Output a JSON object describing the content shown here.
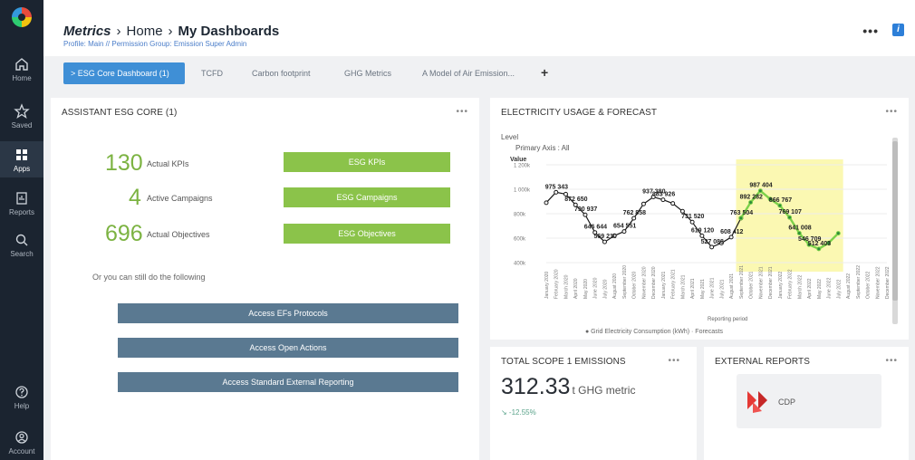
{
  "sidebar": {
    "items": [
      {
        "label": "Home"
      },
      {
        "label": "Saved"
      },
      {
        "label": "Apps"
      },
      {
        "label": "Reports"
      },
      {
        "label": "Search"
      },
      {
        "label": "Help"
      },
      {
        "label": "Account"
      }
    ]
  },
  "header": {
    "crumb1": "Metrics",
    "crumb2": "Home",
    "crumb3": "My Dashboards",
    "subcrumb": "Profile: Main // Permission Group: Emission Super Admin",
    "more": "•••"
  },
  "tabs": [
    {
      "label": "> ESG Core Dashboard (1)"
    },
    {
      "label": "TCFD"
    },
    {
      "label": "Carbon footprint"
    },
    {
      "label": "GHG Metrics"
    },
    {
      "label": "A Model of Air Emission..."
    }
  ],
  "tab_add": "+",
  "esg_panel": {
    "title": "ASSISTANT ESG CORE (1)",
    "more": "•••",
    "kpis": [
      {
        "value": "130",
        "label": "Actual KPIs",
        "button": "ESG KPIs"
      },
      {
        "value": "4",
        "label": "Active Campaigns",
        "button": "ESG Campaigns"
      },
      {
        "value": "696",
        "label": "Actual Objectives",
        "button": "ESG Objectives"
      }
    ],
    "hint": "Or you can still do the following",
    "actions": [
      {
        "label": "Access EFs Protocols"
      },
      {
        "label": "Access Open Actions"
      },
      {
        "label": "Access Standard External Reporting"
      }
    ]
  },
  "electricity_panel": {
    "title": "ELECTRICITY USAGE & FORECAST",
    "more": "•••",
    "level_label": "Level",
    "axis_label": "Primary Axis : All",
    "value_label": "Value",
    "xaxis_title": "Reporting period",
    "legend_text": "● Grid Electricity Consumption (kWh) · Forecasts"
  },
  "chart_data": {
    "type": "line",
    "xlabel": "Reporting period",
    "ylabel": "Value",
    "yticks": [
      "1 200k",
      "1 000k",
      "800k",
      "600k",
      "400k"
    ],
    "ylim": [
      400000,
      1200000
    ],
    "x": [
      "January 2020",
      "February 2020",
      "March 2020",
      "April 2020",
      "May 2020",
      "June 2020",
      "July 2020",
      "August 2020",
      "September 2020",
      "October 2020",
      "November 2020",
      "December 2020",
      "January 2021",
      "February 2021",
      "March 2021",
      "April 2021",
      "May 2021",
      "June 2021",
      "July 2021",
      "August 2021",
      "September 2021",
      "October 2021",
      "November 2021",
      "December 2021",
      "January 2022",
      "February 2022",
      "March 2022",
      "April 2022",
      "May 2022",
      "June 2022",
      "July 2022",
      "August 2022",
      "September 2022",
      "October 2022",
      "November 2022",
      "December 2022"
    ],
    "series": [
      {
        "name": "Grid Electricity Consumption (kWh)",
        "values": [
          890000,
          975343,
          960000,
          872650,
          790937,
          646644,
          569210,
          620000,
          654551,
          762858,
          880000,
          937380,
          913926,
          883926,
          820000,
          731520,
          619120,
          527088,
          560000,
          608412,
          763504,
          null,
          null,
          null,
          null,
          null,
          null,
          null,
          null,
          null,
          null,
          null,
          null,
          null,
          null,
          null
        ],
        "color": "#1a1a1a"
      },
      {
        "name": "Forecasts",
        "values": [
          null,
          null,
          null,
          null,
          null,
          null,
          null,
          null,
          null,
          null,
          null,
          null,
          null,
          null,
          null,
          null,
          null,
          null,
          null,
          null,
          763504,
          892282,
          987404,
          920000,
          866767,
          769107,
          641008,
          546709,
          512403,
          560000,
          640000,
          null,
          null,
          null,
          null,
          null
        ],
        "color": "#7cd14a"
      }
    ],
    "data_labels": [
      {
        "i": 1,
        "text": "975 343"
      },
      {
        "i": 3,
        "text": "872 650"
      },
      {
        "i": 4,
        "text": "790 937"
      },
      {
        "i": 5,
        "text": "646 644"
      },
      {
        "i": 6,
        "text": "569 210"
      },
      {
        "i": 8,
        "text": "654 551"
      },
      {
        "i": 9,
        "text": "762 858"
      },
      {
        "i": 11,
        "text": "937 380"
      },
      {
        "i": 12,
        "text": "883 926"
      },
      {
        "i": 15,
        "text": "731 520"
      },
      {
        "i": 16,
        "text": "619 120"
      },
      {
        "i": 17,
        "text": "527 088"
      },
      {
        "i": 19,
        "text": "608 412"
      },
      {
        "i": 20,
        "text": "763 504"
      },
      {
        "i": 21,
        "text": "892 282"
      },
      {
        "i": 22,
        "text": "987 404"
      },
      {
        "i": 24,
        "text": "866 767"
      },
      {
        "i": 25,
        "text": "769 107"
      },
      {
        "i": 26,
        "text": "641 008"
      },
      {
        "i": 27,
        "text": "546 709"
      },
      {
        "i": 28,
        "text": "512 403"
      }
    ],
    "forecast_band_color": "#fbf8b2"
  },
  "scope_panel": {
    "title": "TOTAL SCOPE 1 EMISSIONS",
    "more": "•••",
    "value": "312.33",
    "unit": "t GHG metric",
    "change": "↘ -12.55%"
  },
  "reports_panel": {
    "title": "EXTERNAL REPORTS",
    "more": "•••",
    "cdp_label": "CDP"
  },
  "colors": {
    "sidebar": "#1b2430",
    "accent": "#3f8fd6",
    "green": "#8bc34a",
    "slate": "#5a7991"
  }
}
